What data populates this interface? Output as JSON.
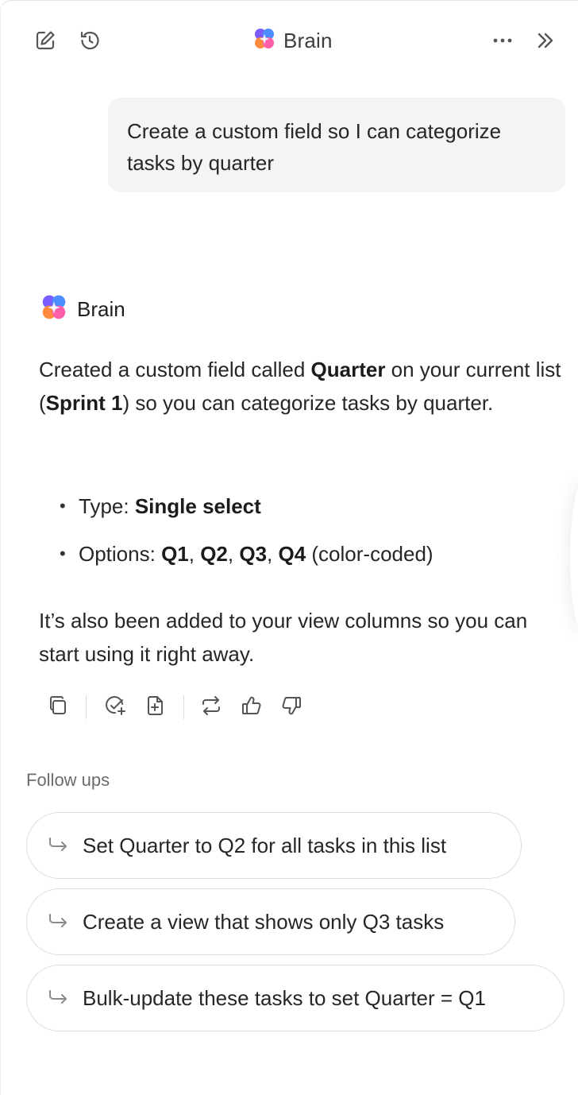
{
  "header": {
    "title": "Brain",
    "icons": [
      "new-chat-icon",
      "history-icon",
      "more-icon",
      "collapse-icon"
    ]
  },
  "user_message": {
    "text": "Create a custom field so I can categorize tasks by quarter"
  },
  "assistant": {
    "name": "Brain",
    "p1_a": "Created a custom field called ",
    "p1_quarter": "Quarter",
    "p1_b": " on your current list (",
    "p1_sprint": "Sprint 1",
    "p1_c": ") so you can categorize tasks by quarter.",
    "bullet1_label": "Type: ",
    "bullet1_value": "Single select",
    "bullet2_label": "Options: ",
    "bullet2_q1": "Q1",
    "bullet2_q2": "Q2",
    "bullet2_q3": "Q3",
    "bullet2_q4": "Q4",
    "bullet2_sep": ", ",
    "bullet2_suffix": " (color-coded)",
    "p2": "It’s also been added to your view columns so you can start using it right away.",
    "action_icons": [
      "copy-icon",
      "create-task-icon",
      "add-doc-icon",
      "regenerate-icon",
      "thumbs-up-icon",
      "thumbs-down-icon"
    ]
  },
  "followups": {
    "label": "Follow ups",
    "items": [
      "Set Quarter to Q2 for all tasks in this list",
      "Create a view that shows only Q3 tasks",
      "Bulk-update these tasks to set Quarter = Q1"
    ]
  },
  "colors": {
    "bubble_bg": "#f4f4f4",
    "text": "#262626",
    "muted": "#6b6b6b",
    "border": "#dedede",
    "logo_purple": "#7b5cff",
    "logo_pink": "#ff5fa8",
    "logo_orange": "#ff8a3d",
    "logo_blue": "#4c8dff"
  }
}
